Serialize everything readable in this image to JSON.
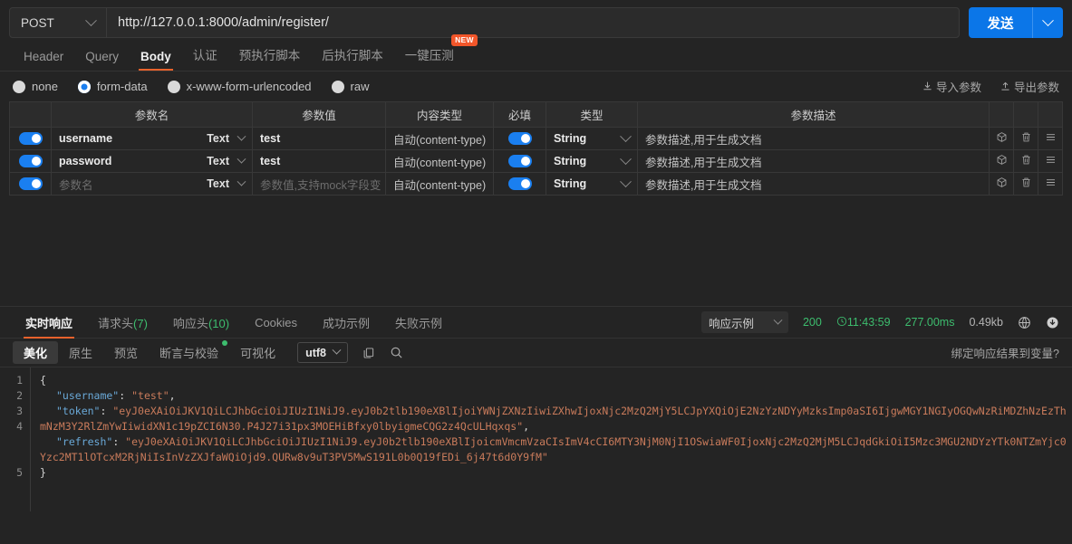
{
  "request": {
    "method": "POST",
    "url": "http://127.0.0.1:8000/admin/register/",
    "send_label": "发送",
    "tabs": [
      {
        "label": "Header",
        "active": false,
        "badge": null
      },
      {
        "label": "Query",
        "active": false,
        "badge": null
      },
      {
        "label": "Body",
        "active": true,
        "badge": null
      },
      {
        "label": "认证",
        "active": false,
        "badge": null
      },
      {
        "label": "预执行脚本",
        "active": false,
        "badge": null
      },
      {
        "label": "后执行脚本",
        "active": false,
        "badge": null
      },
      {
        "label": "一键压测",
        "active": false,
        "badge": "NEW"
      }
    ],
    "body_types": [
      {
        "label": "none",
        "selected": false
      },
      {
        "label": "form-data",
        "selected": true
      },
      {
        "label": "x-www-form-urlencoded",
        "selected": false
      },
      {
        "label": "raw",
        "selected": false
      }
    ],
    "import_label": "导入参数",
    "export_label": "导出参数"
  },
  "params_table": {
    "headers": [
      "",
      "参数名",
      "参数值",
      "内容类型",
      "必填",
      "类型",
      "参数描述",
      "",
      "",
      ""
    ],
    "rows": [
      {
        "enabled": true,
        "name": "username",
        "name_placeholder": "参数名",
        "name_is_placeholder": false,
        "name_type": "Text",
        "value": "test",
        "value_is_placeholder": false,
        "content_type": "自动(content-type)",
        "required": true,
        "type": "String",
        "desc_placeholder": "参数描述,用于生成文档"
      },
      {
        "enabled": true,
        "name": "password",
        "name_placeholder": "参数名",
        "name_is_placeholder": false,
        "name_type": "Text",
        "value": "test",
        "value_is_placeholder": false,
        "content_type": "自动(content-type)",
        "required": true,
        "type": "String",
        "desc_placeholder": "参数描述,用于生成文档"
      },
      {
        "enabled": true,
        "name": "参数名",
        "name_placeholder": "参数名",
        "name_is_placeholder": true,
        "name_type": "Text",
        "value": "参数值,支持mock字段变",
        "value_is_placeholder": true,
        "content_type": "自动(content-type)",
        "required": true,
        "type": "String",
        "desc_placeholder": "参数描述,用于生成文档"
      }
    ]
  },
  "response": {
    "tabs": [
      {
        "label": "实时响应",
        "count": null,
        "active": true
      },
      {
        "label": "请求头",
        "count": "(7)",
        "active": false
      },
      {
        "label": "响应头",
        "count": "(10)",
        "active": false
      },
      {
        "label": "Cookies",
        "count": null,
        "active": false
      },
      {
        "label": "成功示例",
        "count": null,
        "active": false
      },
      {
        "label": "失败示例",
        "count": null,
        "active": false
      }
    ],
    "example_select": "响应示例",
    "status": "200",
    "time": "11:43:59",
    "duration": "277.00ms",
    "size": "0.49kb",
    "view_tabs": [
      {
        "label": "美化",
        "active": true,
        "dot": false
      },
      {
        "label": "原生",
        "active": false,
        "dot": false
      },
      {
        "label": "预览",
        "active": false,
        "dot": false
      },
      {
        "label": "断言与校验",
        "active": false,
        "dot": true
      },
      {
        "label": "可视化",
        "active": false,
        "dot": false
      }
    ],
    "encoding": "utf8",
    "bind_var_label": "绑定响应结果到变量?",
    "line_numbers": [
      "1",
      "2",
      "3",
      "4",
      "5"
    ],
    "body": {
      "open_brace": "{",
      "close_brace": "}",
      "entries": [
        {
          "key": "\"username\"",
          "value": "\"test\"",
          "comma": ","
        },
        {
          "key": "\"token\"",
          "value": "\"eyJ0eXAiOiJKV1QiLCJhbGciOiJIUzI1NiJ9.eyJ0b2tlb190eXBlIjoiYWNjZXNzIiwiZXhwIjoxNjc2MzQ2MjY5LCJpYXQiOjE2NzYzNDYyMzksImp0aSI6IjgwMGY1NGIyOGQwNzRiMDZhNzEzThmNzM3Y2RlZmYwIiwidXN1c19pZCI6N30.P4J27i31px3MOEHiBfxy0lbyigmeCQG2z4QcULHqxqs\"",
          "comma": ","
        },
        {
          "key": "\"refresh\"",
          "value": "\"eyJ0eXAiOiJKV1QiLCJhbGciOiJIUzI1NiJ9.eyJ0b2tlb190eXBlIjoicmVmcmVzaCIsImV4cCI6MTY3NjM0NjI1OSwiaWF0IjoxNjc2MzQ2MjM5LCJqdGkiOiI5Mzc3MGU2NDYzYTk0NTZmYjc0Yzc2MT1lOTcxM2RjNiIsInVzZXJfaWQiOjd9.QURw8v9uT3PV5MwS191L0b0Q19fEDi_6j47t6d0Y9fM\"",
          "comma": ""
        }
      ]
    }
  },
  "icons": {
    "chevron_down": "chevron-down-icon",
    "import": "import-icon",
    "export": "export-icon",
    "mock": "mock-cube-icon",
    "delete": "trash-icon",
    "menu": "hamburger-menu-icon",
    "clock": "clock-icon",
    "globe": "globe-icon",
    "download": "download-icon",
    "copy": "copy-icon",
    "search": "search-icon"
  },
  "colors": {
    "accent_blue": "#0b76e8",
    "accent_orange": "#e8622c",
    "status_green": "#3dbd6e",
    "badge_red": "#f2562a",
    "background": "#242424"
  }
}
